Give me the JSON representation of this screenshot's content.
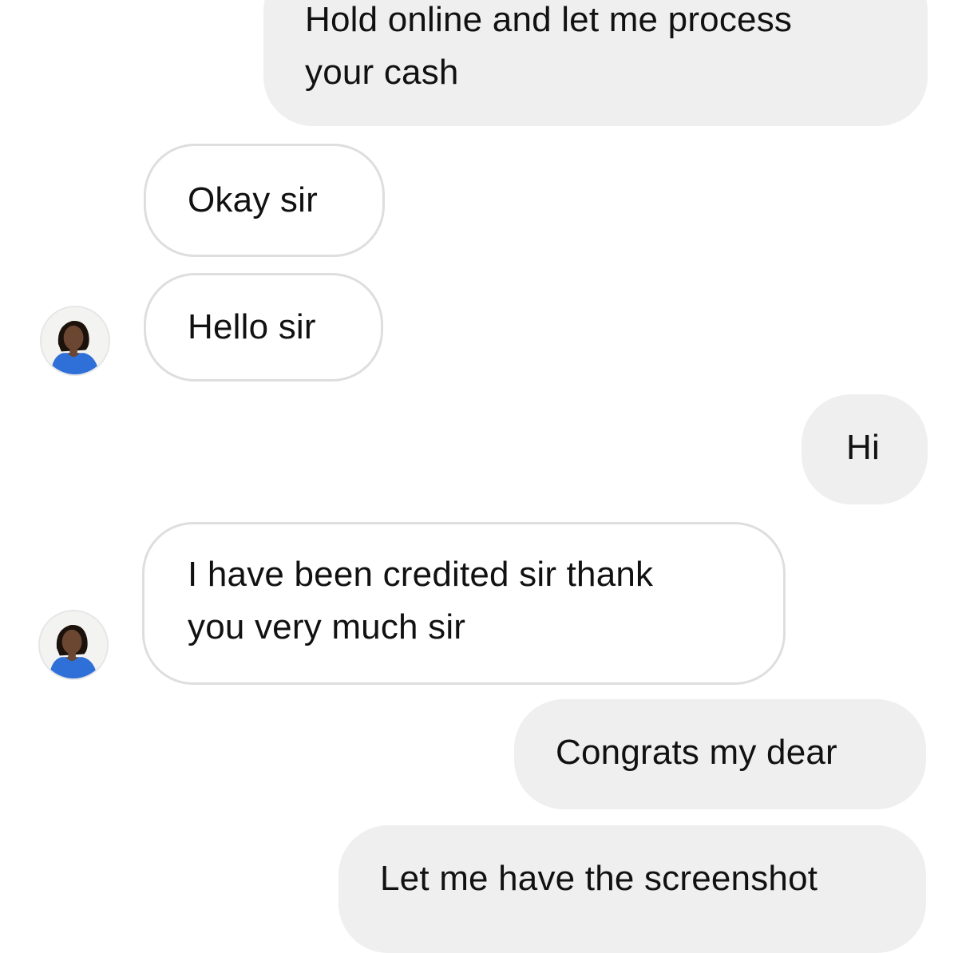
{
  "messages": [
    {
      "id": "m1",
      "direction": "outgoing",
      "text": "Hold online and let me process\nyour cash"
    },
    {
      "id": "m2",
      "direction": "incoming",
      "text": "Okay sir"
    },
    {
      "id": "m3",
      "direction": "incoming",
      "text": "Hello sir"
    },
    {
      "id": "m4",
      "direction": "outgoing",
      "text": "Hi"
    },
    {
      "id": "m5",
      "direction": "incoming",
      "text": "I have been credited sir thank\nyou very much sir"
    },
    {
      "id": "m6",
      "direction": "outgoing",
      "text": "Congrats my dear"
    },
    {
      "id": "m7",
      "direction": "outgoing",
      "text": "Let me have the screenshot"
    }
  ],
  "avatar": {
    "icon": "contact-avatar-photo",
    "colors": {
      "background": "#f3f3f1",
      "shirt": "#2f6fd8",
      "skin": "#6b4631",
      "hair": "#1c120c"
    }
  },
  "colors": {
    "outgoing_bubble": "#efefef",
    "incoming_border": "#dedede",
    "text": "#111111"
  }
}
